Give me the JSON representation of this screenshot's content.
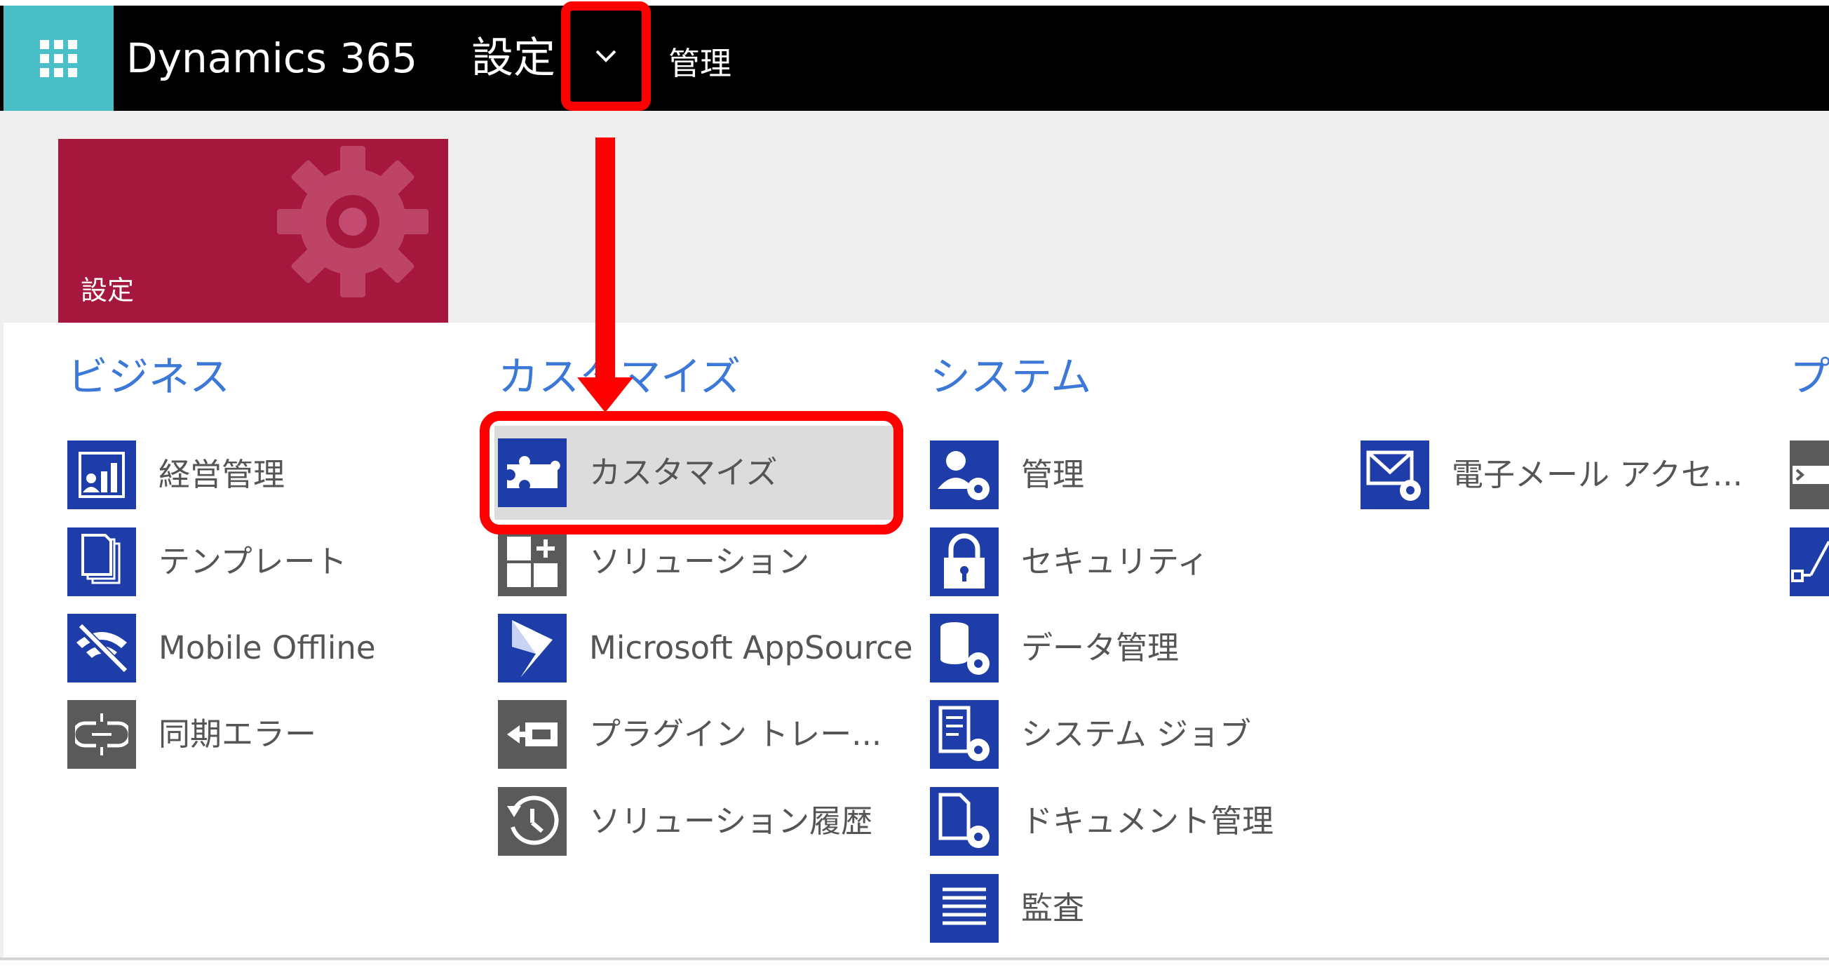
{
  "colors": {
    "accent_blue": "#3C78D8",
    "tile_crimson": "#A5173C",
    "icon_navy": "#1E3DA8",
    "icon_gray": "#5A5A5A",
    "annotation_red": "#FF0000",
    "apps_teal": "#4BBFC8"
  },
  "nav": {
    "brand": "Dynamics 365",
    "area": "設定",
    "dropdown_icon": "chevron-down-icon",
    "subarea": "管理"
  },
  "tile": {
    "label": "設定",
    "icon": "gear-icon"
  },
  "columns": [
    {
      "title": "ビジネス",
      "items": [
        {
          "label": "経営管理",
          "icon": "business-management-icon"
        },
        {
          "label": "テンプレート",
          "icon": "templates-icon"
        },
        {
          "label": "Mobile Offline",
          "icon": "mobile-offline-icon"
        },
        {
          "label": "同期エラー",
          "icon": "sync-error-icon"
        }
      ]
    },
    {
      "title": "カスタマイズ",
      "items": [
        {
          "label": "カスタマイズ",
          "icon": "puzzle-icon",
          "selected": true
        },
        {
          "label": "ソリューション",
          "icon": "solutions-icon"
        },
        {
          "label": "Microsoft AppSource",
          "icon": "dynamics-logo-icon"
        },
        {
          "label": "プラグイン トレー...",
          "icon": "plugin-trace-icon"
        },
        {
          "label": "ソリューション履歴",
          "icon": "history-icon"
        }
      ]
    },
    {
      "title": "システム",
      "items": [
        {
          "label": "管理",
          "icon": "administration-icon"
        },
        {
          "label": "セキュリティ",
          "icon": "lock-icon"
        },
        {
          "label": "データ管理",
          "icon": "data-management-icon"
        },
        {
          "label": "システム ジョブ",
          "icon": "system-jobs-icon"
        },
        {
          "label": "ドキュメント管理",
          "icon": "document-management-icon"
        },
        {
          "label": "監査",
          "icon": "auditing-icon"
        }
      ]
    },
    {
      "title": "",
      "items": [
        {
          "label": "電子メール アクセ...",
          "icon": "email-config-icon"
        }
      ]
    }
  ],
  "partial_column_title": "プ"
}
